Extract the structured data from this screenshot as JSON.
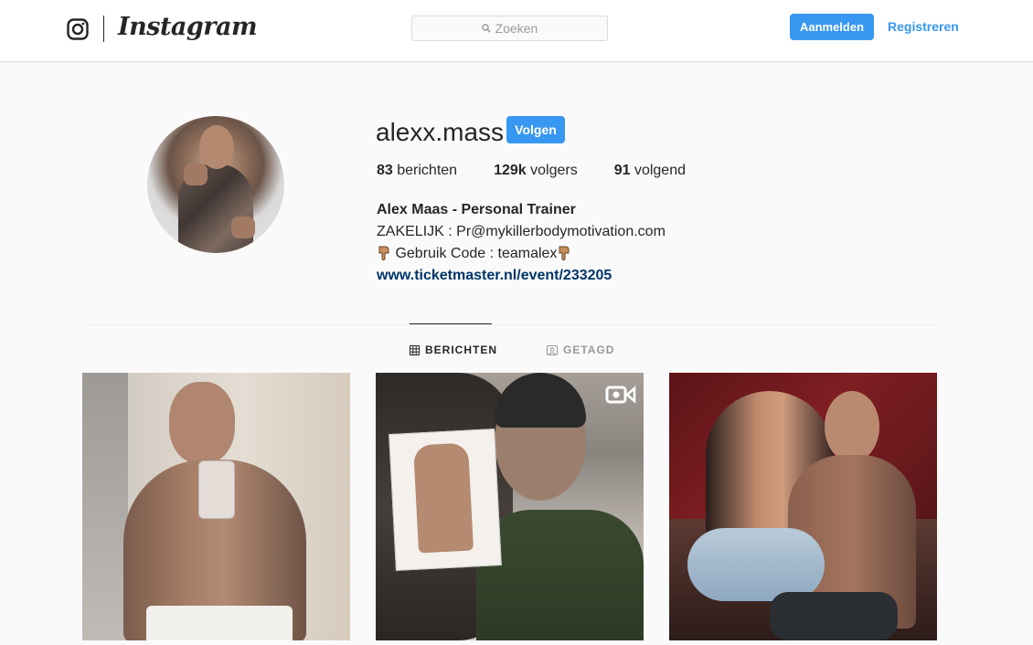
{
  "header": {
    "brand": "Instagram",
    "search_placeholder": "Zoeken",
    "login_label": "Aanmelden",
    "register_label": "Registreren"
  },
  "profile": {
    "username": "alexx.mass",
    "follow_label": "Volgen",
    "stats": {
      "posts_count": "83",
      "posts_label": "berichten",
      "followers_count": "129k",
      "followers_label": "volgers",
      "following_count": "91",
      "following_label": "volgend"
    },
    "bio": {
      "full_name": "Alex Maas - Personal Trainer",
      "line1": "ZAKELIJK : Pr@mykillerbodymotivation.com",
      "line2": "Gebruik Code : teamalex",
      "link": "www.ticketmaster.nl/event/233205"
    }
  },
  "tabs": [
    {
      "label": "BERICHTEN",
      "icon": "grid-icon",
      "active": true
    },
    {
      "label": "GETAGD",
      "icon": "tagged-icon",
      "active": false
    }
  ],
  "posts": [
    {
      "type": "photo"
    },
    {
      "type": "video",
      "icon": "video-icon"
    },
    {
      "type": "photo"
    }
  ],
  "colors": {
    "accent": "#3897f0",
    "link": "#003569",
    "text": "#262626",
    "muted": "#999999",
    "background": "#fafafa"
  }
}
